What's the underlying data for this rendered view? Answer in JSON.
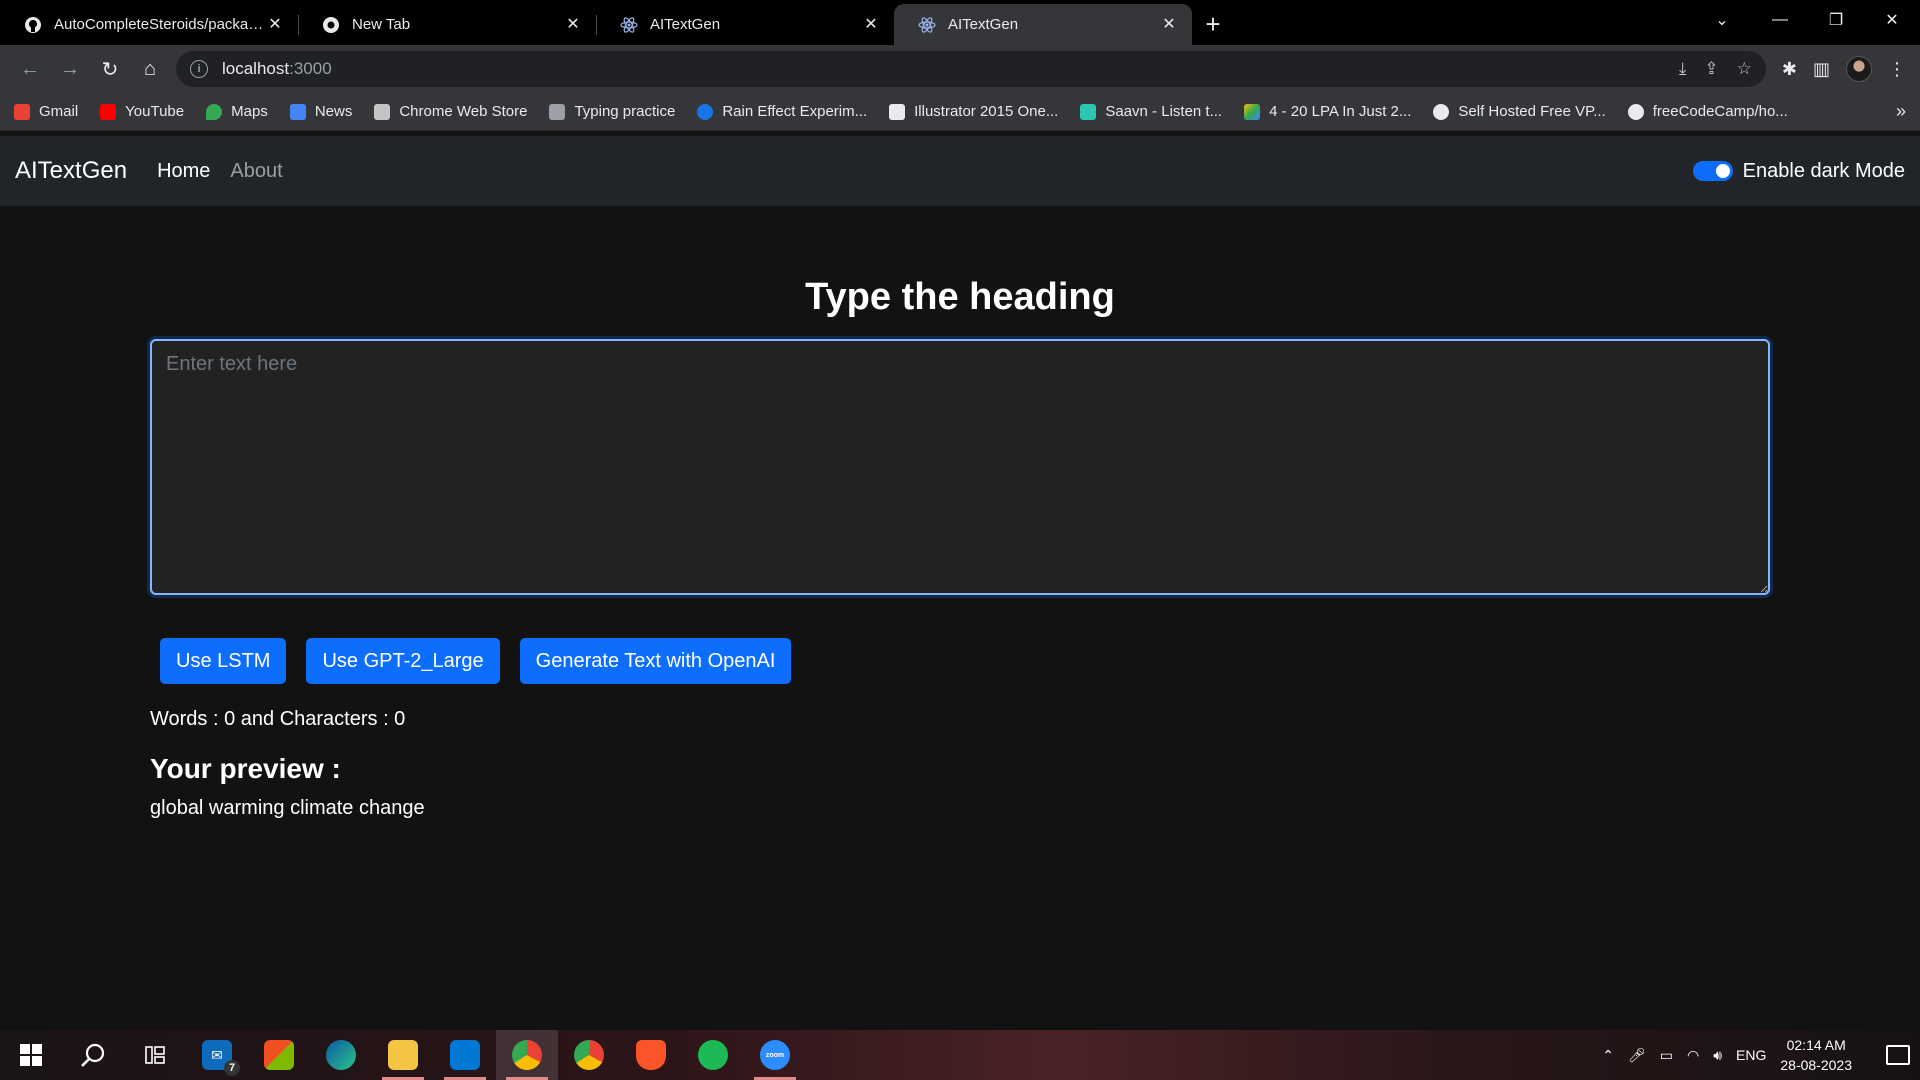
{
  "browser": {
    "tabs": [
      {
        "title": "AutoCompleteSteroids/package.json",
        "active": false
      },
      {
        "title": "New Tab",
        "active": false
      },
      {
        "title": "AITextGen",
        "active": false
      },
      {
        "title": "AITextGen",
        "active": true
      }
    ],
    "url_host": "localhost",
    "url_port": ":3000",
    "bookmarks": [
      {
        "label": "Gmail",
        "color": "#ea4335"
      },
      {
        "label": "YouTube",
        "color": "#ff0000"
      },
      {
        "label": "Maps",
        "color": "#34a853"
      },
      {
        "label": "News",
        "color": "#4285f4"
      },
      {
        "label": "Chrome Web Store",
        "color": "#e8eaed"
      },
      {
        "label": "Typing practice",
        "color": "#9aa0a6"
      },
      {
        "label": "Rain Effect Experim...",
        "color": "#1a73e8"
      },
      {
        "label": "Illustrator 2015 One...",
        "color": "#e8eaed"
      },
      {
        "label": "Saavn - Listen t...",
        "color": "#2bc5b4"
      },
      {
        "label": "4 - 20 LPA In Just 2...",
        "color": "#fbbc04"
      },
      {
        "label": "Self Hosted Free VP...",
        "color": "#e8eaed"
      },
      {
        "label": "freeCodeCamp/ho...",
        "color": "#e8eaed"
      }
    ]
  },
  "navbar": {
    "brand": "AITextGen",
    "links": [
      "Home",
      "About"
    ],
    "dark_mode_label": "Enable dark Mode",
    "dark_mode_on": true
  },
  "main": {
    "heading": "Type the heading",
    "textarea_placeholder": "Enter text here",
    "textarea_value": "",
    "buttons": [
      "Use LSTM",
      "Use GPT-2_Large",
      "Generate Text with OpenAI"
    ],
    "counts": "Words : 0 and Characters : 0",
    "preview_title": "Your preview :",
    "preview_text": "global warming climate change"
  },
  "taskbar": {
    "apps": [
      {
        "name": "mail",
        "badge": "7"
      },
      {
        "name": "store"
      },
      {
        "name": "edge"
      },
      {
        "name": "file-explorer"
      },
      {
        "name": "vscode"
      },
      {
        "name": "chrome"
      },
      {
        "name": "chrome-profile"
      },
      {
        "name": "brave"
      },
      {
        "name": "spotify"
      },
      {
        "name": "zoom",
        "label": "zoom"
      }
    ],
    "language": "ENG",
    "time": "02:14 AM",
    "date": "28-08-2023"
  },
  "colors": {
    "accent": "#0d6efd",
    "page_bg": "#121212",
    "navbar_bg": "#212529"
  }
}
